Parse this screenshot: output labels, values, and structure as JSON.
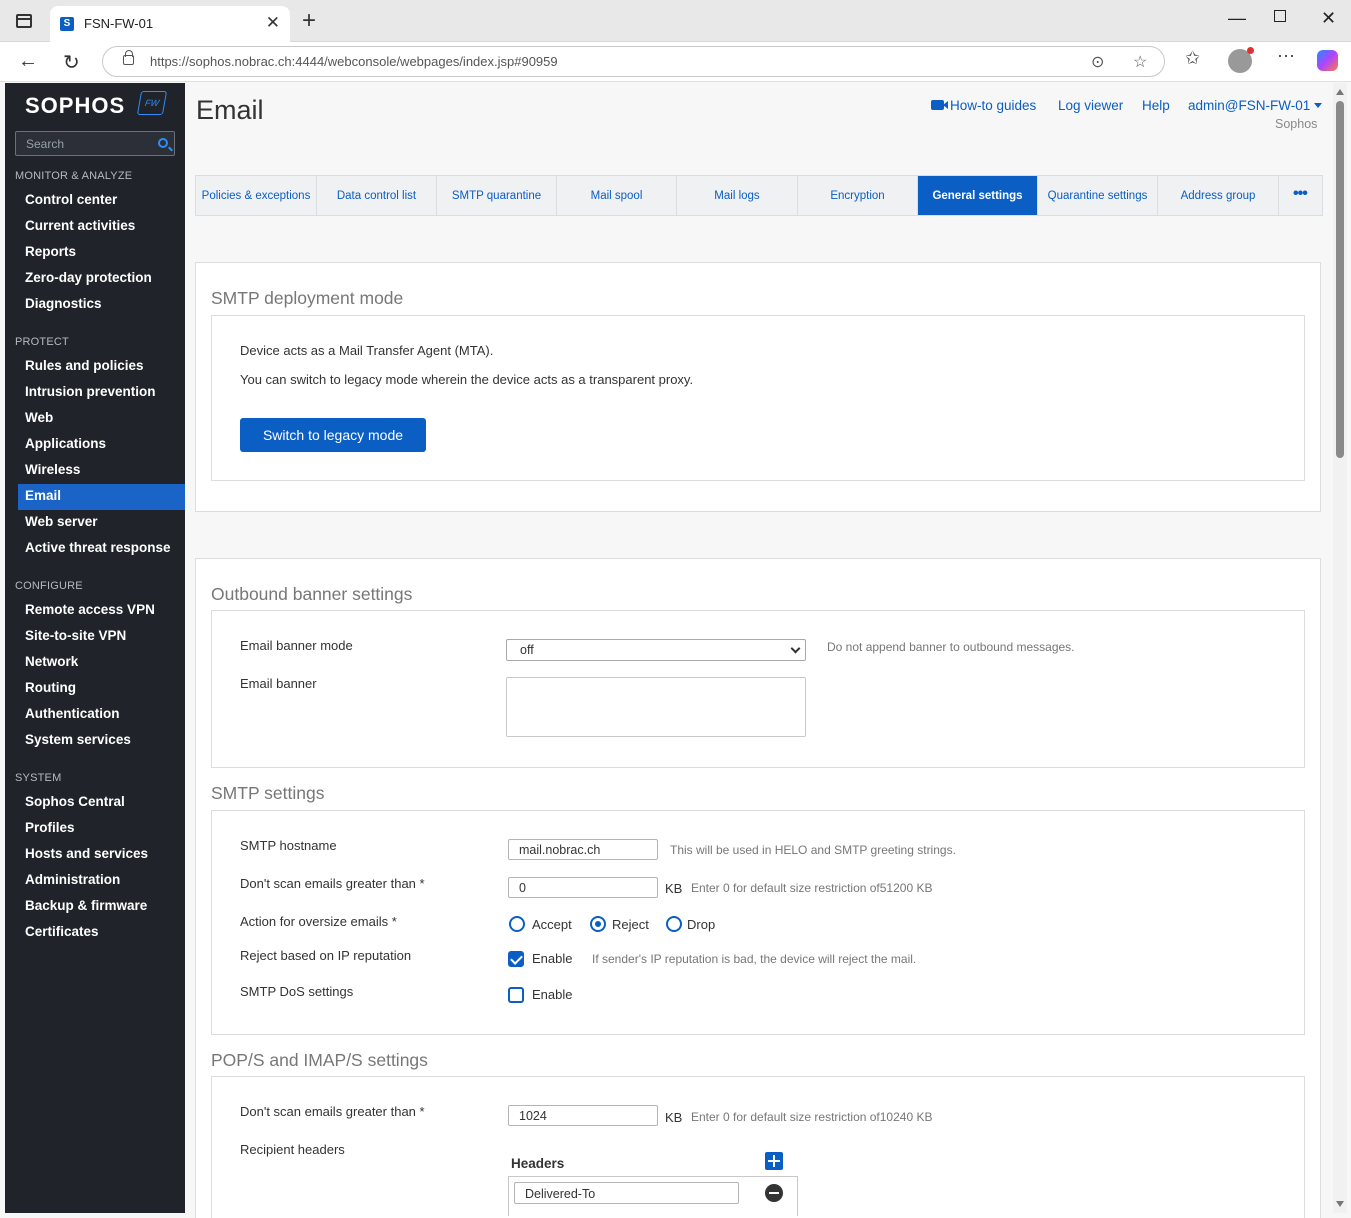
{
  "browser": {
    "tab_title": "FSN-FW-01",
    "url": "https://sophos.nobrac.ch:4444/webconsole/webpages/index.jsp#90959"
  },
  "sidebar": {
    "logo": "SOPHOS",
    "badge": "FW",
    "search_placeholder": "Search",
    "sections": [
      {
        "label": "MONITOR & ANALYZE",
        "items": [
          "Control center",
          "Current activities",
          "Reports",
          "Zero-day protection",
          "Diagnostics"
        ]
      },
      {
        "label": "PROTECT",
        "items": [
          "Rules and policies",
          "Intrusion prevention",
          "Web",
          "Applications",
          "Wireless",
          "Email",
          "Web server",
          "Active threat response"
        ]
      },
      {
        "label": "CONFIGURE",
        "items": [
          "Remote access VPN",
          "Site-to-site VPN",
          "Network",
          "Routing",
          "Authentication",
          "System services"
        ]
      },
      {
        "label": "SYSTEM",
        "items": [
          "Sophos Central",
          "Profiles",
          "Hosts and services",
          "Administration",
          "Backup & firmware",
          "Certificates"
        ]
      }
    ],
    "active_item": "Email"
  },
  "header": {
    "title": "Email",
    "links": {
      "howto": "How-to guides",
      "logviewer": "Log viewer",
      "help": "Help",
      "user": "admin@FSN-FW-01"
    },
    "org": "Sophos"
  },
  "tabs": [
    {
      "label": "Policies & exceptions",
      "active": false
    },
    {
      "label": "Data control list",
      "active": false
    },
    {
      "label": "SMTP quarantine",
      "active": false
    },
    {
      "label": "Mail spool",
      "active": false
    },
    {
      "label": "Mail logs",
      "active": false
    },
    {
      "label": "Encryption",
      "active": false
    },
    {
      "label": "General settings",
      "active": true
    },
    {
      "label": "Quarantine settings",
      "active": false
    },
    {
      "label": "Address group",
      "active": false
    }
  ],
  "tabs_more": "•••",
  "deployment": {
    "title": "SMTP deployment mode",
    "line1": "Device acts as a Mail Transfer Agent (MTA).",
    "line2": "You can switch to legacy mode wherein the device acts as a transparent proxy.",
    "button": "Switch to legacy mode"
  },
  "banner": {
    "title": "Outbound banner settings",
    "mode_label": "Email banner mode",
    "mode_value": "off",
    "mode_hint": "Do not append banner to outbound messages.",
    "banner_label": "Email banner"
  },
  "smtp": {
    "title": "SMTP settings",
    "hostname_label": "SMTP hostname",
    "hostname_value": "mail.nobrac.ch",
    "hostname_hint": "This will be used in HELO and SMTP greeting strings.",
    "maxsize_label": "Don't scan emails greater than *",
    "maxsize_value": "0",
    "maxsize_unit": "KB",
    "maxsize_hint": "Enter 0 for default size restriction of51200 KB",
    "oversize_label": "Action for oversize emails *",
    "oversize_options": [
      "Accept",
      "Reject",
      "Drop"
    ],
    "oversize_selected": "Reject",
    "iprep_label": "Reject based on IP reputation",
    "iprep_enable": "Enable",
    "iprep_checked": true,
    "iprep_hint": "If sender's IP reputation is bad, the device will reject the mail.",
    "dos_label": "SMTP DoS settings",
    "dos_enable": "Enable",
    "dos_checked": false
  },
  "pop": {
    "title": "POP/S and IMAP/S settings",
    "maxsize_label": "Don't scan emails greater than *",
    "maxsize_value": "1024",
    "maxsize_unit": "KB",
    "maxsize_hint": "Enter 0 for default size restriction of10240 KB",
    "recipient_label": "Recipient headers",
    "headers_title": "Headers",
    "headers": [
      "Delivered-To"
    ]
  }
}
